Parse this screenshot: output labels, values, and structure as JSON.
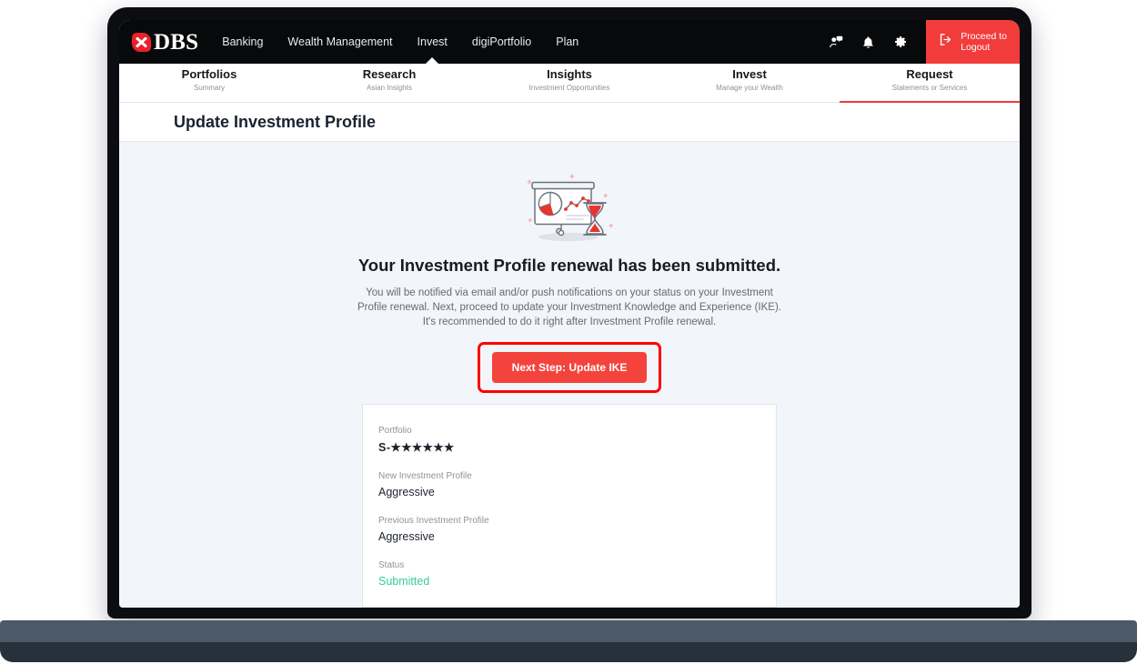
{
  "brand": {
    "logo_mark": "dbs-cross-mark",
    "logo_text": "DBS"
  },
  "topnav": {
    "links": [
      {
        "label": "Banking",
        "active": false
      },
      {
        "label": "Wealth Management",
        "active": false
      },
      {
        "label": "Invest",
        "active": true
      },
      {
        "label": "digiPortfolio",
        "active": false
      },
      {
        "label": "Plan",
        "active": false
      }
    ],
    "icons": [
      {
        "name": "contact-support-icon"
      },
      {
        "name": "notification-bell-icon"
      },
      {
        "name": "settings-gear-icon"
      }
    ],
    "logout": {
      "icon": "logout-arrow-icon",
      "line1": "Proceed to",
      "line2": "Logout"
    }
  },
  "subtabs": [
    {
      "title": "Portfolios",
      "subtitle": "Summary",
      "active": false
    },
    {
      "title": "Research",
      "subtitle": "Asian Insights",
      "active": false
    },
    {
      "title": "Insights",
      "subtitle": "Investment Opportunities",
      "active": false
    },
    {
      "title": "Invest",
      "subtitle": "Manage your Wealth",
      "active": false
    },
    {
      "title": "Request",
      "subtitle": "Statements or Services",
      "active": true
    }
  ],
  "page": {
    "title": "Update Investment Profile"
  },
  "main": {
    "illustration_name": "presentation-chart-hourglass-illustration",
    "heading": "Your Investment Profile renewal has been submitted.",
    "body": "You will be notified via email and/or push notifications on your status on your Investment Profile renewal. Next, proceed to update your Investment Knowledge and Experience (IKE). It's recommended to do it right after Investment Profile renewal.",
    "cta_label": "Next Step: Update IKE"
  },
  "details": {
    "fields": [
      {
        "label": "Portfolio",
        "value": "S-★★★★★★",
        "kind": "masked"
      },
      {
        "label": "New Investment Profile",
        "value": "Aggressive",
        "kind": "text"
      },
      {
        "label": "Previous Investment Profile",
        "value": "Aggressive",
        "kind": "text"
      },
      {
        "label": "Status",
        "value": "Submitted",
        "kind": "status"
      }
    ]
  },
  "colors": {
    "brand_red": "#e8212c",
    "cta_red": "#f4433c",
    "annotation_red": "#ff0000",
    "status_green": "#36cf94",
    "nav_black": "#08090b",
    "page_bg": "#f2f5f9"
  }
}
